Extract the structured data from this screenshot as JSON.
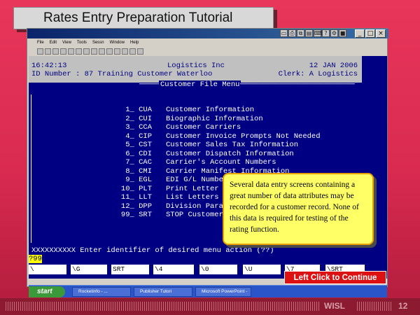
{
  "slide": {
    "title": "Rates Entry Preparation Tutorial",
    "footer_brand": "WISL",
    "page_number": "12"
  },
  "window": {
    "menu_items": [
      "File",
      "Edit",
      "View",
      "Tools",
      "Sessn",
      "Window",
      "Help"
    ],
    "controls": [
      "_",
      "□",
      "×"
    ],
    "icon_names": [
      "window-icon",
      "printer-icon",
      "copy-icon",
      "paste-icon",
      "keyboard-icon",
      "help-icon"
    ]
  },
  "terminal": {
    "time": "16:42:13",
    "company": "Logistics Inc",
    "date": "12 JAN 2006",
    "id_line": "ID Number : 87 Training Customer Waterloo",
    "clerk": "Clerk: A Logistics",
    "menu_title": "Customer File Menu",
    "menu_items": [
      {
        "code": "1_ CUA",
        "label": "Customer Information"
      },
      {
        "code": "2_ CUI",
        "label": "Biographic Information"
      },
      {
        "code": "3_ CCA",
        "label": "Customer Carriers"
      },
      {
        "code": "4_ CIP",
        "label": "Customer Invoice Prompts Not Needed"
      },
      {
        "code": "5_ CST",
        "label": "Customer Sales Tax Information"
      },
      {
        "code": "6_ CDI",
        "label": "Customer Dispatch Information"
      },
      {
        "code": "7_ CAC",
        "label": "Carrier's Account Numbers"
      },
      {
        "code": "8_ CMI",
        "label": "Carrier Manifest Information"
      },
      {
        "code": "9_ EGL",
        "label": "EDI G/L Numbe"
      },
      {
        "code": "10_ PLT",
        "label": "Print Letter"
      },
      {
        "code": "11_ LLT",
        "label": "List Letters"
      },
      {
        "code": "12_ DPP",
        "label": "Division Para"
      },
      {
        "code": "99_ SRT",
        "label": "STOP Customer"
      }
    ],
    "prompt": "XXXXXXXXXX Enter identifier of desired menu action (??)",
    "input_value": "?99",
    "function_keys": [
      "\\",
      "\\G",
      "SRT",
      "\\4",
      "\\0",
      "\\U",
      "\\7",
      "\\SRT"
    ]
  },
  "callout": {
    "text": "Several data entry screens containing a great number of data attributes may be recorded for a customer record. None of this data is required for testing of the rating function."
  },
  "continue_button": {
    "label": "Left Click to Continue"
  },
  "taskbar": {
    "start_label": "start",
    "items": [
      "Rocketinfo - ...",
      "Publisher Tutori",
      "Microsoft PowerPoint -"
    ]
  }
}
